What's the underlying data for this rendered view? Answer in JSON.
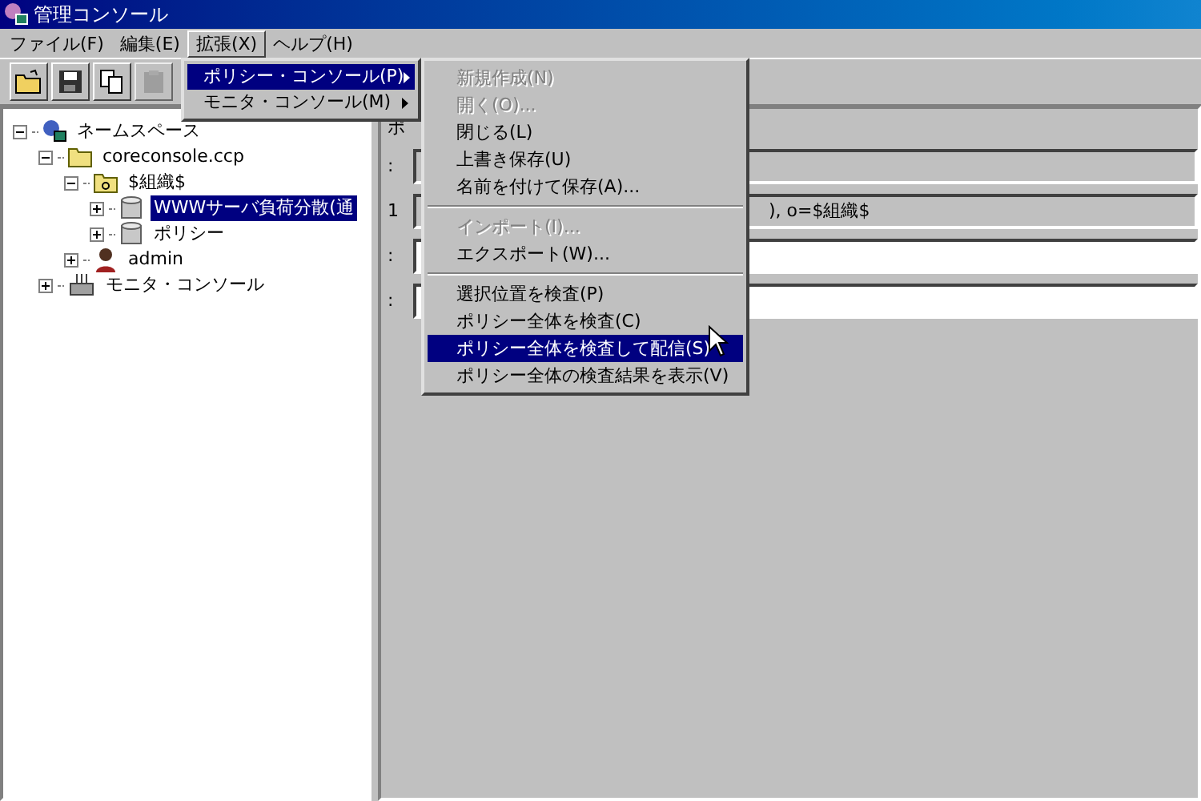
{
  "window": {
    "title": "管理コンソール"
  },
  "menubar": [
    {
      "label": "ファイル(F)",
      "selected": false
    },
    {
      "label": "編集(E)",
      "selected": false
    },
    {
      "label": "拡張(X)",
      "selected": true
    },
    {
      "label": "ヘルプ(H)",
      "selected": false
    }
  ],
  "toolbar": [
    {
      "kind": "open",
      "disabled": false
    },
    {
      "kind": "save",
      "disabled": false
    },
    {
      "kind": "copy",
      "disabled": false
    },
    {
      "kind": "paste",
      "disabled": true
    }
  ],
  "tree": [
    {
      "label": "ネームスペース",
      "kind": "namespace",
      "expanded": true,
      "selected": false,
      "children": [
        {
          "label": "coreconsole.ccp",
          "kind": "project",
          "expanded": true,
          "selected": false,
          "children": [
            {
              "label": "$組織$",
              "kind": "organization",
              "expanded": true,
              "selected": false,
              "children": [
                {
                  "label": "WWWサーバ負荷分散(通",
                  "kind": "policy",
                  "expanded": false,
                  "selected": true
                },
                {
                  "label": "ポリシー",
                  "kind": "policy",
                  "expanded": false,
                  "selected": false
                }
              ]
            },
            {
              "label": "admin",
              "kind": "user",
              "expanded": false,
              "selected": false
            }
          ]
        },
        {
          "label": "モニタ・コンソール",
          "kind": "monitor",
          "expanded": false,
          "selected": false
        }
      ]
    }
  ],
  "detail": {
    "header": "ポ",
    "rows": [
      {
        "label": ":",
        "value": "",
        "kind": "gray"
      },
      {
        "label": "1",
        "value": "), o=$組織$",
        "kind": "gray"
      },
      {
        "label": ":",
        "value": "",
        "kind": "white"
      },
      {
        "label": ":",
        "value": "",
        "kind": "white"
      }
    ]
  },
  "menu": [
    {
      "label": "ポリシー・コンソール(P)",
      "selected": true
    },
    {
      "label": "モニタ・コンソール(M)",
      "selected": false
    }
  ],
  "submenu": [
    {
      "kind": "item",
      "label": "新規作成(N)",
      "disabled": true,
      "selected": false
    },
    {
      "kind": "item",
      "label": "開く(O)...",
      "disabled": true,
      "selected": false
    },
    {
      "kind": "item",
      "label": "閉じる(L)",
      "disabled": false,
      "selected": false
    },
    {
      "kind": "item",
      "label": "上書き保存(U)",
      "disabled": false,
      "selected": false
    },
    {
      "kind": "item",
      "label": "名前を付けて保存(A)...",
      "disabled": false,
      "selected": false
    },
    {
      "kind": "separator"
    },
    {
      "kind": "item",
      "label": "インポート(I)...",
      "disabled": true,
      "selected": false
    },
    {
      "kind": "item",
      "label": "エクスポート(W)...",
      "disabled": false,
      "selected": false
    },
    {
      "kind": "separator"
    },
    {
      "kind": "item",
      "label": "選択位置を検査(P)",
      "disabled": false,
      "selected": false
    },
    {
      "kind": "item",
      "label": "ポリシー全体を検査(C)",
      "disabled": false,
      "selected": false
    },
    {
      "kind": "item",
      "label": "ポリシー全体を検査して配信(S)",
      "disabled": false,
      "selected": true
    },
    {
      "kind": "item",
      "label": "ポリシー全体の検査結果を表示(V)",
      "disabled": false,
      "selected": false
    }
  ]
}
